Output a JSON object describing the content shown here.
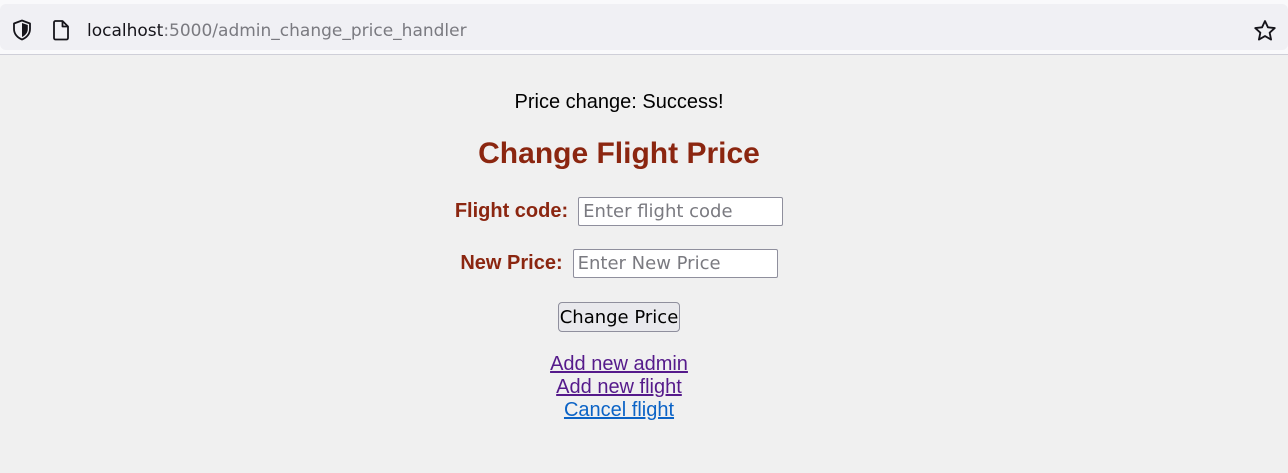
{
  "browser": {
    "url_host": "localhost",
    "url_rest": ":5000/admin_change_price_handler",
    "icons": [
      "shield-icon",
      "page-icon",
      "bookmark-star-icon"
    ]
  },
  "page": {
    "status_message": "Price change: Success!",
    "title": "Change Flight Price",
    "form": {
      "flight_code_label": "Flight code:",
      "flight_code_placeholder": "Enter flight code",
      "new_price_label": "New Price:",
      "new_price_placeholder": "Enter New Price",
      "submit_label": "Change Price"
    },
    "links": {
      "add_admin": "Add new admin",
      "add_flight": "Add new flight",
      "cancel_flight": "Cancel flight"
    }
  },
  "colors": {
    "title": "#8b2610",
    "visited_link": "#551a8b",
    "link": "#0b63c6",
    "page_background": "#f0f0f0"
  }
}
